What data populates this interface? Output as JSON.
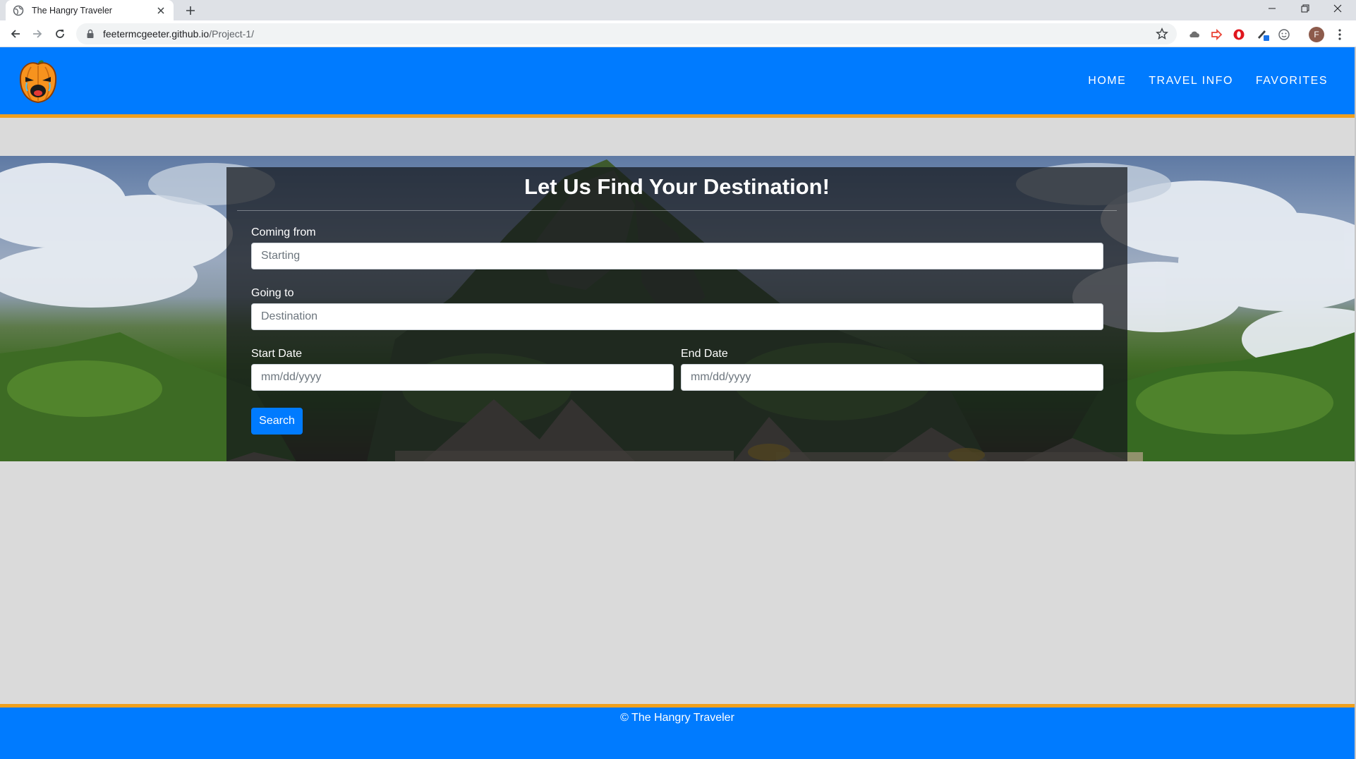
{
  "browser": {
    "tab_title": "The Hangry Traveler",
    "url_host": "feetermcgeeter.github.io",
    "url_path": "/Project-1/",
    "profile_initial": "F"
  },
  "navbar": {
    "logo_icon": "crying-pumpkin-logo",
    "links": [
      {
        "label": "HOME"
      },
      {
        "label": "TRAVEL INFO"
      },
      {
        "label": "FAVORITES"
      }
    ]
  },
  "search_form": {
    "title": "Let Us Find Your Destination!",
    "coming_from_label": "Coming from",
    "coming_from_placeholder": "Starting",
    "going_to_label": "Going to",
    "going_to_placeholder": "Destination",
    "start_date_label": "Start Date",
    "start_date_placeholder": "mm/dd/yyyy",
    "end_date_label": "End Date",
    "end_date_placeholder": "mm/dd/yyyy",
    "search_label": "Search"
  },
  "footer": {
    "text": "© The Hangry Traveler"
  },
  "colors": {
    "brand_blue": "#007bff",
    "accent_orange": "#f0a01e",
    "page_background": "#dadada"
  }
}
